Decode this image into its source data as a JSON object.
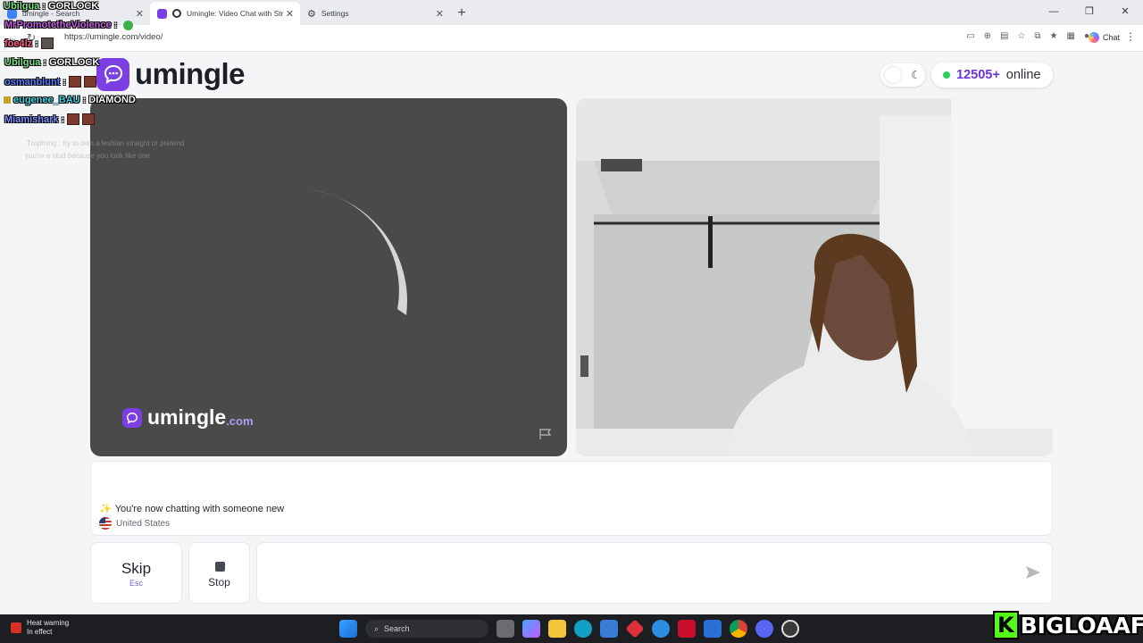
{
  "browser": {
    "tabs": [
      {
        "label": "umingle - Search",
        "active": false
      },
      {
        "label": "Umingle: Video Chat with Str",
        "active": true
      },
      {
        "label": "Settings",
        "active": false
      }
    ],
    "url": "https://umingle.com/video/",
    "chat_button": "Chat"
  },
  "header": {
    "logo_text": "umingle",
    "online_count": "12505+",
    "online_label": "online"
  },
  "video_left": {
    "watermark_main": "umingle",
    "watermark_suffix": ".com"
  },
  "chat": {
    "message_emoji": "✨",
    "message": "You're now chatting with someone new",
    "country": "United States"
  },
  "controls": {
    "skip_label": "Skip",
    "skip_shortcut": "Esc",
    "stop_label": "Stop",
    "input_placeholder": ""
  },
  "stream_overlay": [
    {
      "user": "Ubilgua",
      "text": ": GORLOCK",
      "color": "#7ee08a"
    },
    {
      "user": "MrPromotetheViolence",
      "text": ":",
      "color": "#c25fe0"
    },
    {
      "user": "foe4lz",
      "text": ":",
      "color": "#ff5c8a"
    },
    {
      "user": "Ubilgua",
      "text": ": GORLOCK",
      "color": "#7ee08a"
    },
    {
      "user": "osmanblunt",
      "text": ":",
      "color": "#5a7dff"
    },
    {
      "user": "eugenee_BAU",
      "text": ": DIAMOND",
      "color": "#3fd0e0"
    },
    {
      "user": "Miamishark",
      "text": ":",
      "color": "#7a8cff"
    }
  ],
  "overlay_faint": [
    "Trophvng : try to own a lesbian straight or pretend",
    "you're a stud because you look like one"
  ],
  "taskbar": {
    "alert_title": "Heat warning",
    "alert_sub": "In effect",
    "search_label": "Search"
  },
  "streamer_watermark": {
    "k": "K",
    "name": "BIGLOAAF"
  },
  "colors": {
    "brand": "#7b3fe4",
    "online_dot": "#2fcf5f",
    "left_video_bg": "#4a4a4a"
  }
}
